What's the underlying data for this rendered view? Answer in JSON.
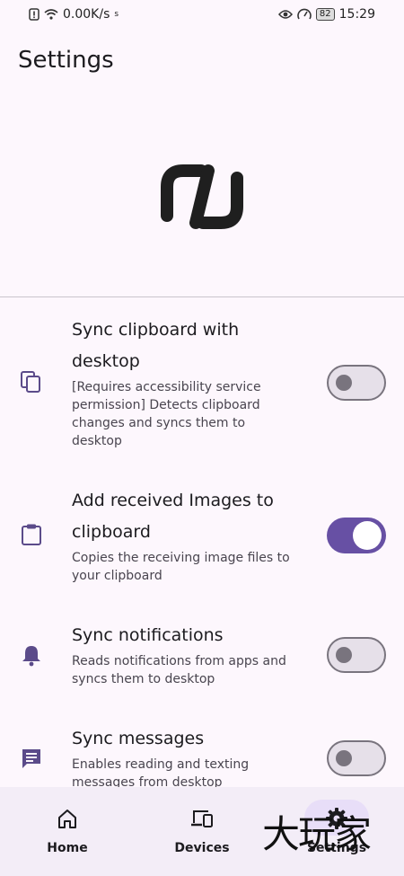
{
  "status_bar": {
    "speed": "0.00K/s",
    "small_glyph": "s",
    "battery": "82",
    "time": "15:29"
  },
  "header": {
    "title": "Settings"
  },
  "settings": [
    {
      "title": "Sync clipboard with desktop",
      "description": "[Requires accessibility service permission] Detects clipboard changes and syncs them to desktop",
      "icon": "copy-icon",
      "enabled": false
    },
    {
      "title": "Add received Images to clipboard",
      "description": "Copies the receiving image files to your clipboard",
      "icon": "clipboard-icon",
      "enabled": true
    },
    {
      "title": "Sync notifications",
      "description": "Reads notifications from apps and syncs them to desktop",
      "icon": "bell-icon",
      "enabled": false
    },
    {
      "title": "Sync messages",
      "description": "Enables reading and texting messages from desktop",
      "icon": "message-icon",
      "enabled": false
    }
  ],
  "bottom_nav": [
    {
      "label": "Home",
      "icon": "home-icon",
      "selected": false
    },
    {
      "label": "Devices",
      "icon": "devices-icon",
      "selected": false
    },
    {
      "label": "Settings",
      "icon": "gear-icon",
      "selected": true
    }
  ],
  "watermark": "大玩家",
  "colors": {
    "background": "#fdf7fd",
    "accent": "#6750a4",
    "nav_background": "#f3edf7",
    "selected_pill": "#e8def8"
  }
}
